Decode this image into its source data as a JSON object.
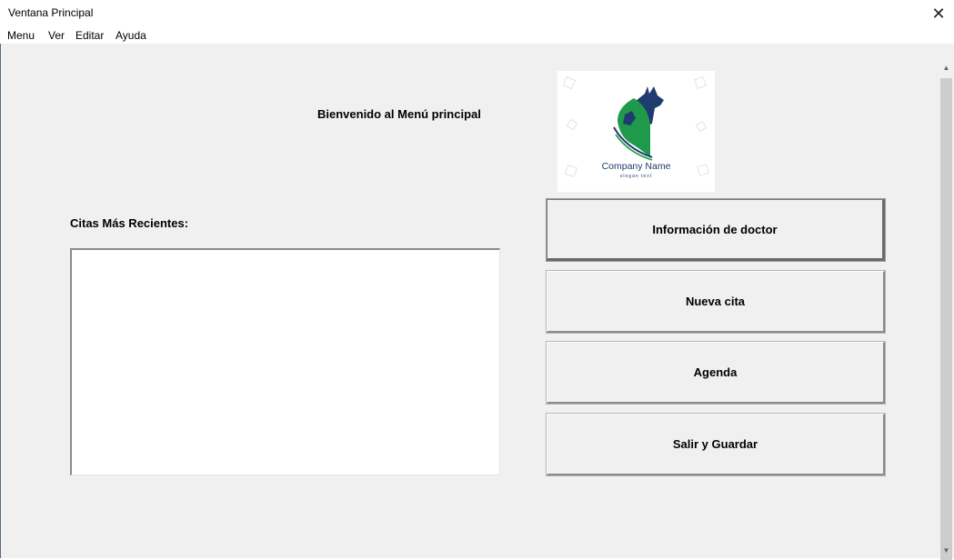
{
  "window": {
    "title": "Ventana Principal",
    "close_glyph": "✕"
  },
  "menubar": {
    "items": [
      "Menu",
      "Ver",
      "Editar",
      "Ayuda"
    ]
  },
  "main": {
    "welcome_text": "Bienvenido al Menú principal",
    "recent_label": "Citas Más Recientes:",
    "recent_items": []
  },
  "logo": {
    "company_name": "Company Name",
    "slogan": "slogan text",
    "colors": {
      "green": "#1f9a4a",
      "navy": "#1f3b6f"
    }
  },
  "buttons": {
    "doctor_info": "Información de doctor",
    "new_appointment": "Nueva cita",
    "agenda": "Agenda",
    "save_exit": "Salir y Guardar"
  },
  "scrollbar": {
    "up_glyph": "▲",
    "down_glyph": "▼"
  }
}
